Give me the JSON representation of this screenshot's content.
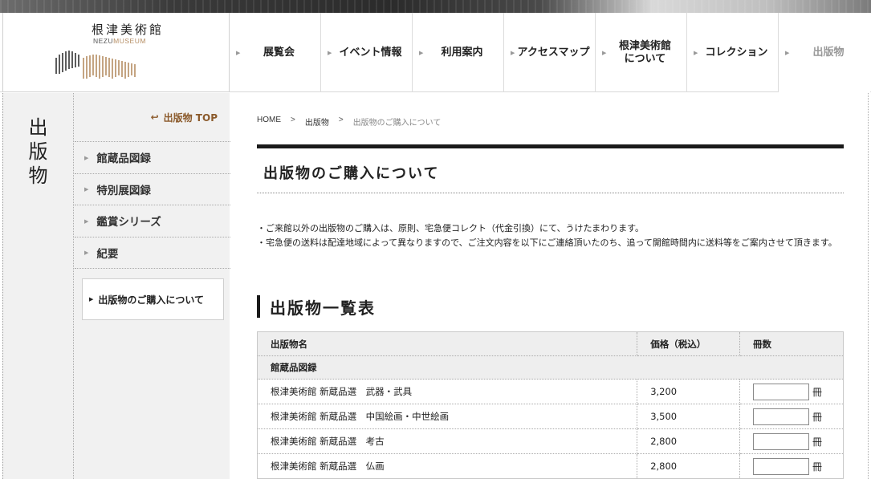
{
  "header": {
    "logo_jp": "根津美術館",
    "logo_en_dark": "NEZU",
    "logo_en_gold": "MUSEUM",
    "nav": [
      {
        "label": "展覧会"
      },
      {
        "label": "イベント情報"
      },
      {
        "label": "利用案内"
      },
      {
        "label": "アクセスマップ"
      },
      {
        "label": "根津美術館\nについて"
      },
      {
        "label": "コレクション"
      },
      {
        "label": "出版物"
      }
    ]
  },
  "sidebar": {
    "title": [
      "出",
      "版",
      "物"
    ],
    "top_link": "出版物 TOP",
    "items": [
      {
        "label": "館蔵品図録"
      },
      {
        "label": "特別展図録"
      },
      {
        "label": "鑑賞シリーズ"
      },
      {
        "label": "紀要"
      }
    ],
    "current": "出版物のご購入について"
  },
  "breadcrumb": {
    "home": "HOME",
    "sep": ">",
    "level1": "出版物",
    "current": "出版物のご購入について"
  },
  "main": {
    "page_title": "出版物のご購入について",
    "notes": [
      "・ご来館以外の出版物のご購入は、原則、宅急便コレクト（代金引換）にて、うけたまわります。",
      "・宅急便の送料は配達地域によって異なりますので、ご注文内容を以下にご連絡頂いたのち、追って開館時間内に送料等をご案内させて頂きます。"
    ],
    "section_title": "出版物一覧表"
  },
  "table": {
    "headers": {
      "name": "出版物名",
      "price": "価格（税込）",
      "qty": "冊数"
    },
    "category": "館蔵品図録",
    "unit": "冊",
    "rows": [
      {
        "name": "根津美術館 新蔵品選　武器・武具",
        "price": "3,200",
        "qty": ""
      },
      {
        "name": "根津美術館 新蔵品選　中国絵画・中世絵画",
        "price": "3,500",
        "qty": ""
      },
      {
        "name": "根津美術館 新蔵品選　考古",
        "price": "2,800",
        "qty": ""
      },
      {
        "name": "根津美術館 新蔵品選　仏画",
        "price": "2,800",
        "qty": ""
      }
    ]
  }
}
